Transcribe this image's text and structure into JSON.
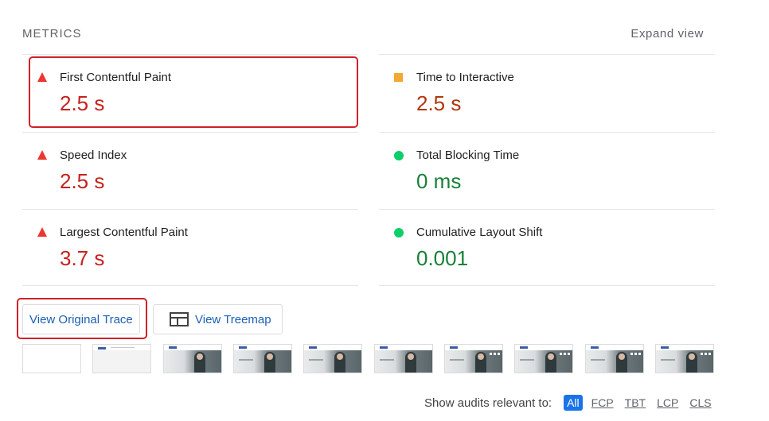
{
  "header": {
    "title": "METRICS",
    "expand_label": "Expand view"
  },
  "metrics": [
    {
      "label": "First Contentful Paint",
      "value": "2.5 s",
      "rating": "fail",
      "indicator": "red-triangle-icon"
    },
    {
      "label": "Time to Interactive",
      "value": "2.5 s",
      "rating": "average",
      "indicator": "orange-square-icon"
    },
    {
      "label": "Speed Index",
      "value": "2.5 s",
      "rating": "fail",
      "indicator": "red-triangle-icon"
    },
    {
      "label": "Total Blocking Time",
      "value": "0 ms",
      "rating": "pass",
      "indicator": "green-circle-icon"
    },
    {
      "label": "Largest Contentful Paint",
      "value": "3.7 s",
      "rating": "fail",
      "indicator": "red-triangle-icon"
    },
    {
      "label": "Cumulative Layout Shift",
      "value": "0.001",
      "rating": "pass",
      "indicator": "green-circle-icon"
    }
  ],
  "buttons": {
    "view_trace": "View Original Trace",
    "view_treemap": "View Treemap"
  },
  "audits": {
    "label": "Show audits relevant to:",
    "filters": [
      "All",
      "FCP",
      "TBT",
      "LCP",
      "CLS"
    ],
    "active": "All"
  },
  "colors": {
    "fail": "#c5221f",
    "average": "#c33300",
    "pass": "#188038",
    "link": "#1a5fb4",
    "highlight": "#d0202a",
    "active_chip": "#1a73e8"
  }
}
